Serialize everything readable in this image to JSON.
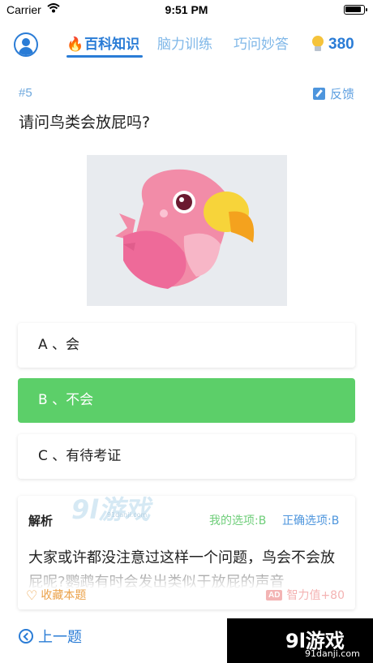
{
  "status_bar": {
    "carrier": "Carrier",
    "time": "9:51 PM"
  },
  "header": {
    "tabs": [
      {
        "label": "百科知识",
        "active": true,
        "icon": "fire-icon"
      },
      {
        "label": "脑力训练",
        "active": false
      },
      {
        "label": "巧问妙答",
        "active": false
      }
    ],
    "score": "380",
    "score_icon": "lightbulb-icon"
  },
  "question": {
    "number": "#5",
    "feedback_label": "反馈",
    "text": "请问鸟类会放屁吗?",
    "image_icon": "parrot-illustration"
  },
  "options": [
    {
      "label": "A 、会",
      "state": "default"
    },
    {
      "label": "B 、不会",
      "state": "selected"
    },
    {
      "label": "C 、有待考证",
      "state": "default"
    }
  ],
  "analysis": {
    "title": "解析",
    "my_choice": "我的选项:B",
    "correct_choice": "正确选项:B",
    "text": "大家或许都没注意过这样一个问题，鸟会不会放屁呢?鹦鹉有时会发出类似于放屁的声音",
    "favorite_label": "收藏本题",
    "ad_badge": "AD",
    "reward_label": "智力值+80"
  },
  "footer": {
    "prev_label": "上一题"
  },
  "watermarks": {
    "center": "9l游戏",
    "center_sub": "91danji.com",
    "corner": "9l游戏",
    "corner_sub": "91danji.com"
  },
  "colors": {
    "primary": "#2a7cd6",
    "selected_option": "#5ccf69",
    "favorite": "#eba24a",
    "reward": "#f4b3b3"
  }
}
